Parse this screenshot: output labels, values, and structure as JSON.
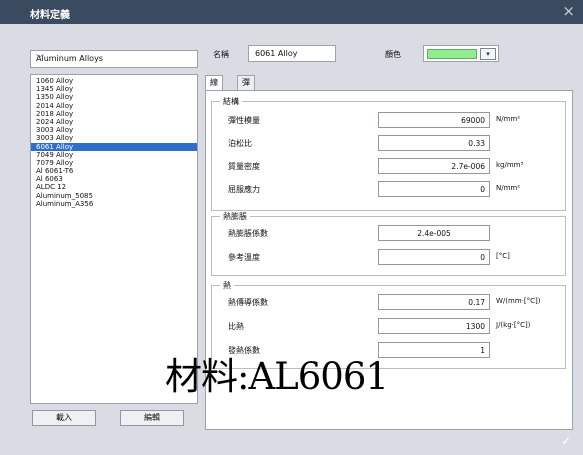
{
  "window": {
    "title": "材料定義",
    "close_glyph": "×"
  },
  "category_select": {
    "value": "Aluminum Alloys",
    "chevron": "﹀"
  },
  "material_list": {
    "items": [
      "1060 Alloy",
      "1345 Alloy",
      "1350 Alloy",
      "2014 Alloy",
      "2018 Alloy",
      "2024 Alloy",
      "3003 Alloy",
      "3003 Alloy",
      "6061 Alloy",
      "7049 Alloy",
      "7079 Alloy",
      "Al 6061-T6",
      "Al 6063",
      "ALDC 12",
      "Aluminum_5085",
      "Aluminum_A356"
    ],
    "selected": "6061 Alloy"
  },
  "buttons": {
    "load": "載入",
    "edit": "編輯"
  },
  "name": {
    "label": "名稱",
    "value": "6061 Alloy"
  },
  "color": {
    "label": "顏色",
    "swatch": "#90ee90",
    "drop": "▾"
  },
  "tabs": [
    {
      "label": "線性"
    },
    {
      "label": "彈塑性"
    }
  ],
  "groups": {
    "structure": {
      "title": "結構",
      "rows": [
        {
          "label": "彈性模量",
          "value": "69000",
          "unit": "N/mm²"
        },
        {
          "label": "泊松比",
          "value": "0.33",
          "unit": ""
        },
        {
          "label": "質量密度",
          "value": "2.7e-006",
          "unit": "kg/mm³"
        },
        {
          "label": "屈服應力",
          "value": "0",
          "unit": "N/mm²"
        }
      ]
    },
    "thermal_expansion": {
      "title": "熱膨脹",
      "rows": [
        {
          "label": "熱膨脹係數",
          "value": "2.4e-005",
          "unit": ""
        },
        {
          "label": "參考溫度",
          "value": "0",
          "unit": "[°C]"
        }
      ]
    },
    "heat": {
      "title": "熱",
      "rows": [
        {
          "label": "熱傳導係數",
          "value": "0.17",
          "unit": "W/(mm·[°C])"
        },
        {
          "label": "比熱",
          "value": "1300",
          "unit": "J/(kg·[°C])"
        },
        {
          "label": "發熱係數",
          "value": "1",
          "unit": ""
        }
      ]
    }
  },
  "overlay_text": "材料:AL6061",
  "ok_glyph": "✓"
}
